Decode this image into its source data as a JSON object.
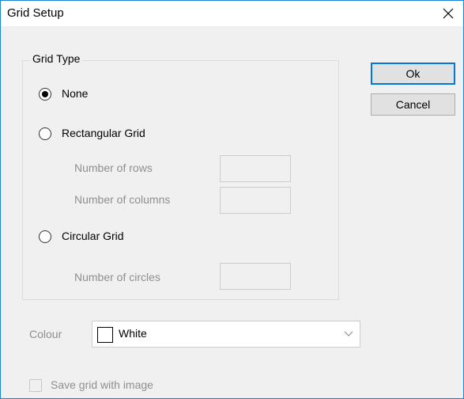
{
  "window": {
    "title": "Grid Setup"
  },
  "grid_type": {
    "legend": "Grid Type",
    "options": [
      {
        "label": "None",
        "selected": true
      },
      {
        "label": "Rectangular Grid",
        "selected": false
      },
      {
        "label": "Circular Grid",
        "selected": false
      }
    ],
    "rows_label": "Number of rows",
    "rows_value": "",
    "columns_label": "Number of columns",
    "columns_value": "",
    "circles_label": "Number of circles",
    "circles_value": ""
  },
  "buttons": {
    "ok_label": "Ok",
    "cancel_label": "Cancel"
  },
  "colour": {
    "label": "Colour",
    "selected_value": "White",
    "swatch_color": "#ffffff"
  },
  "save_grid": {
    "label": "Save grid with image",
    "checked": false
  },
  "colors": {
    "accent": "#0078d7",
    "window_border": "#1883d7",
    "disabled_text": "#8f8f8f",
    "dialog_background": "#f0f0f0"
  }
}
